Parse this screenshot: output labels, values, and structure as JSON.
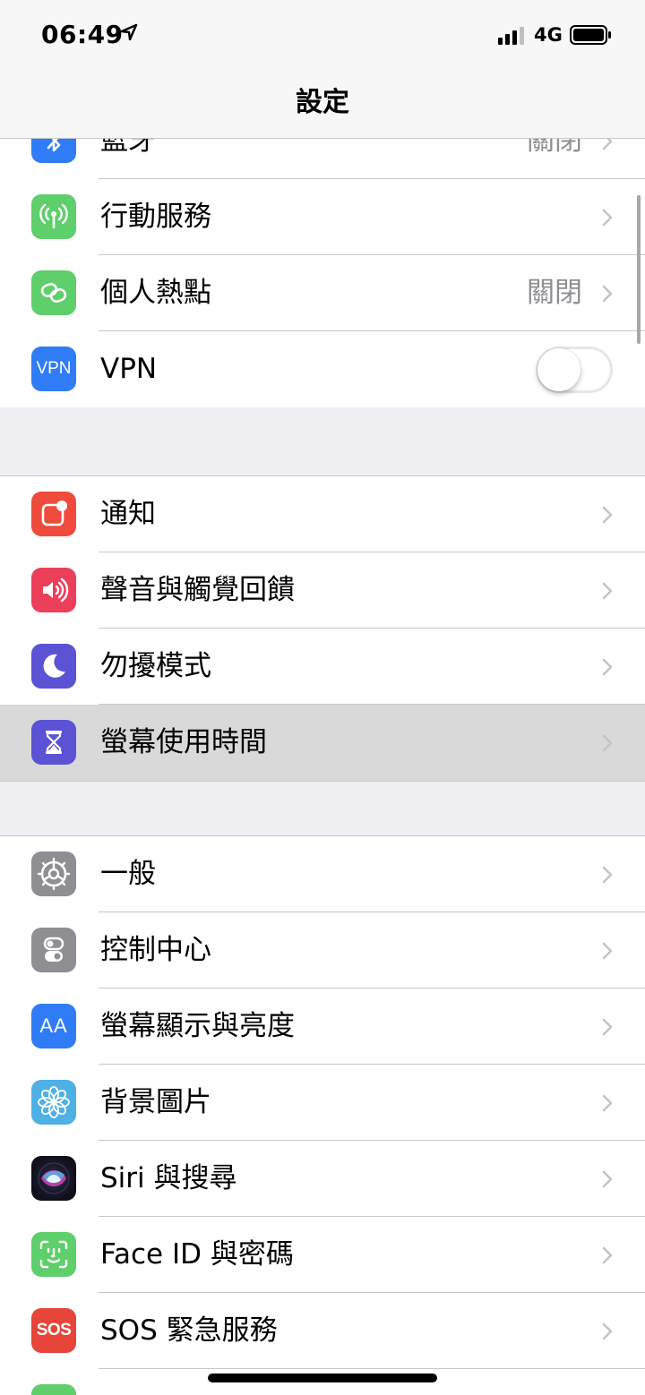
{
  "status": {
    "time": "06:49",
    "network": "4G"
  },
  "nav": {
    "title": "設定"
  },
  "groups": [
    {
      "rows": [
        {
          "label": "藍牙",
          "value": "關閉",
          "icon": "bluetooth-icon",
          "color": "#2f7cf6"
        },
        {
          "label": "行動服務",
          "value": "",
          "icon": "antenna-icon",
          "color": "#5fcf6b"
        },
        {
          "label": "個人熱點",
          "value": "關閉",
          "icon": "link-icon",
          "color": "#5fcf6b"
        },
        {
          "label": "VPN",
          "icon": "vpn-icon",
          "icon_text": "VPN",
          "color": "#2f7cf6",
          "toggle_on": false
        }
      ]
    },
    {
      "rows": [
        {
          "label": "通知",
          "icon": "notification-icon",
          "color": "#ef4b3d"
        },
        {
          "label": "聲音與觸覺回饋",
          "icon": "speaker-icon",
          "color": "#ec3f5a"
        },
        {
          "label": "勿擾模式",
          "icon": "moon-icon",
          "color": "#5b52d6"
        },
        {
          "label": "螢幕使用時間",
          "icon": "hourglass-icon",
          "color": "#5b52d6"
        }
      ]
    },
    {
      "rows": [
        {
          "label": "一般",
          "icon": "gear-icon",
          "color": "#8e8e93"
        },
        {
          "label": "控制中心",
          "icon": "toggles-icon",
          "color": "#8e8e93"
        },
        {
          "label": "螢幕顯示與亮度",
          "icon": "text-size-icon",
          "icon_text": "AA",
          "color": "#2f7cf6"
        },
        {
          "label": "背景圖片",
          "icon": "flower-icon",
          "color": "#4fb0e5"
        },
        {
          "label": "Siri 與搜尋",
          "icon": "siri-icon",
          "color": "#1a1a2e"
        },
        {
          "label": "Face ID 與密碼",
          "icon": "face-id-icon",
          "color": "#5fcf6b"
        },
        {
          "label": "SOS 緊急服務",
          "icon": "sos-icon",
          "icon_text": "SOS",
          "color": "#e7443a"
        }
      ]
    }
  ]
}
